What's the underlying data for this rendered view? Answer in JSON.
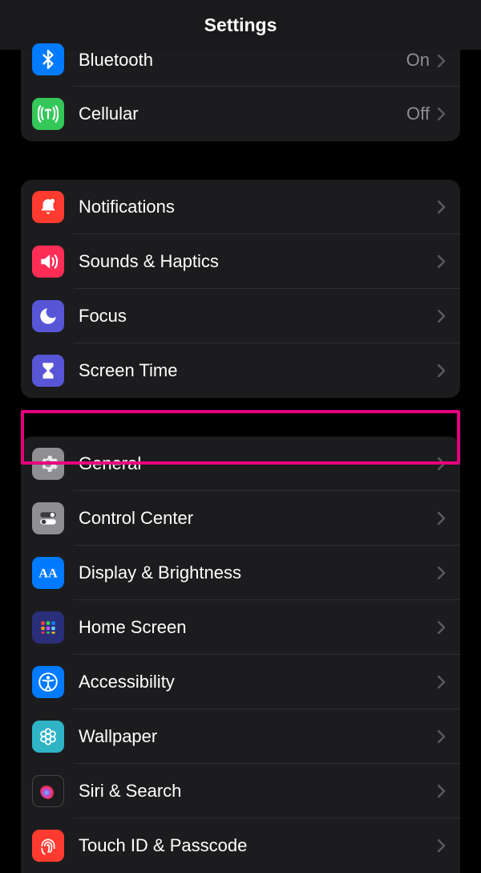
{
  "header": {
    "title": "Settings"
  },
  "group1": {
    "bluetooth": {
      "label": "Bluetooth",
      "value": "On"
    },
    "cellular": {
      "label": "Cellular",
      "value": "Off"
    }
  },
  "group2": {
    "notifications": {
      "label": "Notifications"
    },
    "sounds": {
      "label": "Sounds & Haptics"
    },
    "focus": {
      "label": "Focus"
    },
    "screentime": {
      "label": "Screen Time"
    }
  },
  "group3": {
    "general": {
      "label": "General"
    },
    "control": {
      "label": "Control Center"
    },
    "display": {
      "label": "Display & Brightness"
    },
    "home": {
      "label": "Home Screen"
    },
    "access": {
      "label": "Accessibility"
    },
    "wallpaper": {
      "label": "Wallpaper"
    },
    "siri": {
      "label": "Siri & Search"
    },
    "touchid": {
      "label": "Touch ID & Passcode"
    }
  },
  "highlight": {
    "target": "general"
  }
}
